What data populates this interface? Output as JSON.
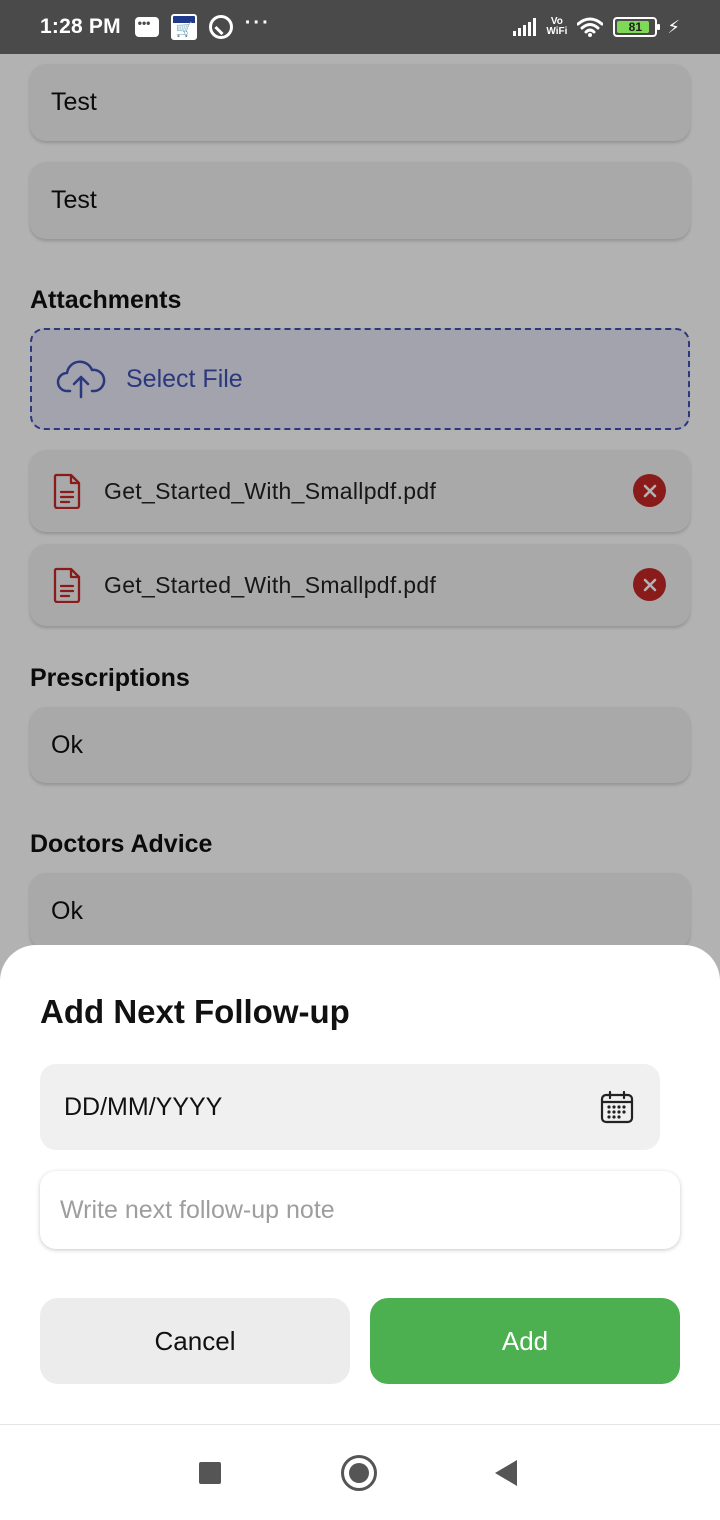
{
  "status_bar": {
    "time": "1:28 PM",
    "battery_level": "81",
    "vowifi_label_top": "Vo",
    "vowifi_label_bottom": "WiFi"
  },
  "form": {
    "field_1_value": "Test",
    "field_2_value": "Test",
    "attachments_label": "Attachments",
    "select_file_label": "Select File",
    "attachments": [
      {
        "name": "Get_Started_With_Smallpdf.pdf"
      },
      {
        "name": "Get_Started_With_Smallpdf.pdf"
      }
    ],
    "prescriptions_label": "Prescriptions",
    "prescriptions_value": "Ok",
    "doctors_advice_label": "Doctors Advice",
    "doctors_advice_value": "Ok"
  },
  "sheet": {
    "title": "Add Next Follow-up",
    "date_placeholder": "DD/MM/YYYY",
    "note_placeholder": "Write next follow-up note",
    "cancel_label": "Cancel",
    "add_label": "Add"
  },
  "colors": {
    "accent_green": "#4caf50",
    "accent_indigo": "#3f51b5",
    "remove_red": "#c62828",
    "pdf_red": "#c62828"
  },
  "icons": [
    "chat-icon",
    "amazon-icon",
    "circle-a-icon",
    "more-dots-icon",
    "signal-icon",
    "wifi-icon",
    "battery-icon",
    "charging-bolt-icon",
    "upload-cloud-icon",
    "pdf-file-icon",
    "remove-circle-icon",
    "calendar-icon",
    "nav-recents-icon",
    "nav-home-icon",
    "nav-back-icon"
  ]
}
